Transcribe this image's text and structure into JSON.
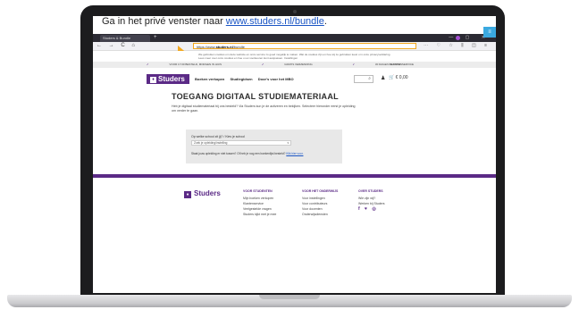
{
  "caption": {
    "text": "Ga in het privé venster naar ",
    "link": "www.studers.nl/bundle",
    "end": "."
  },
  "browser": {
    "tab_title": "Studers & Bundle",
    "tab_add": "+",
    "window_controls": "— ▢ ✕",
    "nav_icons": "← → C ⌂",
    "url_prefix": "https://www.",
    "url_domain": "studers.nl",
    "url_path": "/bundle",
    "right_icons": "⋯ ♡ ☆   ⫼ ◫ ≡"
  },
  "cookie": {
    "line1": "We gebruiken cookies om deze website en onze service zo goed mogelijk te maken. Wat de cookies zijn en hoe wij ze gebruiken leest u in onze privacyverklaring.",
    "line2": "Lees meer over onze cookies en hoe u uw voorkeuren kunt aanpassen.  Instellingen"
  },
  "usp": {
    "items": [
      "VOOR 17:00 BESTELD, MORGEN IN HUIS",
      "GRATIS VERZENDING",
      "30 DAGEN RETOUR"
    ],
    "right": "KLANTENSERVICE"
  },
  "header": {
    "logo": "Studers",
    "nav": [
      "Boeken verkopen",
      "Studiegidsen",
      "Door's voor het MBO"
    ],
    "cart_amount": "€ 0,00",
    "side_button": "≡"
  },
  "content": {
    "title": "TOEGANG DIGITAAL STUDIEMATERIAAL",
    "intro": "Heb je digitaal studiemateriaal bij ons besteld? Via Studers kun je de activeren en bekijken. Selecteer hieronder eerst je opleiding om verder te gaan.",
    "form_label": "Op welke school zit jij? / Kies je school",
    "select_placeholder": "Zoek je opleiding/instelling",
    "hint": "Staat jouw opleiding er niet tussen? Of heb je nog een boekenlijst besteld? ",
    "hint_link": "Klik hier voor."
  },
  "footer": {
    "logo": "Studers",
    "columns": [
      {
        "head": "VOOR STUDENTEN",
        "items": [
          "Mijn boeken verkopen",
          "Klantenservice",
          "Veelgestelde vragen",
          "Studers kijkt met je mee"
        ]
      },
      {
        "head": "VOOR HET ONDERWIJS",
        "items": [
          "Voor instellingen",
          "Voor contributeurs",
          "Voor docenten",
          "Onderwijsdiensten"
        ]
      },
      {
        "head": "OVER STUDERS",
        "items": [
          "Wie zijn wij?",
          "Werken bij Studers"
        ]
      }
    ],
    "social": "f ♥ ◎"
  }
}
